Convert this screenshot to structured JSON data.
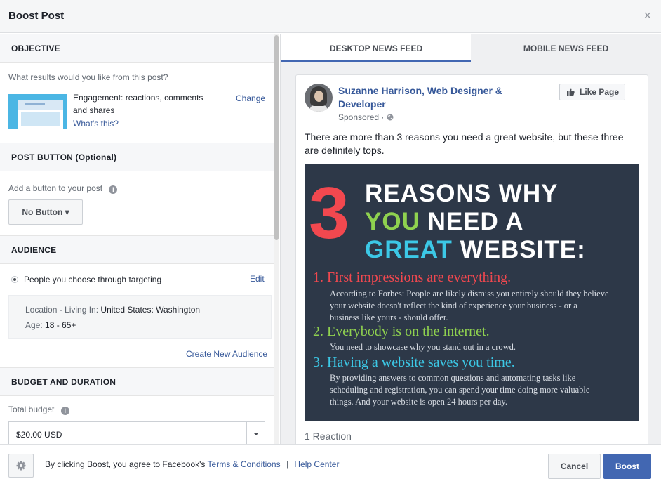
{
  "dialog": {
    "title": "Boost Post",
    "close_glyph": "×"
  },
  "objective": {
    "heading": "OBJECTIVE",
    "question": "What results would you like from this post?",
    "choice_line1": "Engagement: reactions, comments",
    "choice_line2": "and shares",
    "whats_this": "What's this?",
    "change": "Change"
  },
  "post_button": {
    "heading": "POST BUTTON (Optional)",
    "label": "Add a button to your post",
    "info_glyph": "i",
    "selected": "No Button",
    "caret": "▾"
  },
  "audience": {
    "heading": "AUDIENCE",
    "option": "People you choose through targeting",
    "edit": "Edit",
    "location_label": "Location - Living In:",
    "location_value": "United States: Washington",
    "age_label": "Age:",
    "age_value": "18 - 65+",
    "create_new": "Create New Audience"
  },
  "budget": {
    "heading": "BUDGET AND DURATION",
    "total_label": "Total budget",
    "info_glyph": "i",
    "value": "$20.00 USD"
  },
  "preview": {
    "tabs": [
      {
        "label": "DESKTOP NEWS FEED",
        "active": true
      },
      {
        "label": "MOBILE NEWS FEED",
        "active": false
      }
    ],
    "page_name_line1": "Suzanne Harrison, Web Designer &",
    "page_name_line2": "Developer",
    "sponsored": "Sponsored · ",
    "globe_glyph": "🌐",
    "like_page": "Like Page",
    "text_line1": "There are more than 3 reasons you need a great website, but these three",
    "text_line2": "are definitely tops.",
    "image": {
      "number": "3",
      "line1": "REASONS WHY",
      "line2a": "YOU",
      "line2b": "NEED A",
      "line3a": "GREAT",
      "line3b": "WEBSITE:",
      "p1_title": "1.  First impressions are everything.",
      "p1_body1": "According to Forbes: People are likely dismiss you entirely should they believe",
      "p1_body2": "your website doesn't reflect the kind of experience your business - or a",
      "p1_body3": "business like yours - should offer.",
      "p2_title": "2.  Everybody is on the internet.",
      "p2_body1": "You need to showcase why you stand out in a crowd.",
      "p3_title": "3.  Having a website saves you time.",
      "p3_body1": "By providing answers to common questions and automating tasks like",
      "p3_body2": "scheduling and registration, you can spend your time doing more valuable",
      "p3_body3": "things. And your website is open 24 hours per day."
    },
    "reactions": "1 Reaction"
  },
  "footer": {
    "agree_text": "By clicking Boost, you agree to Facebook's",
    "terms": "Terms & Conditions",
    "separator": "|",
    "help_center": "Help Center",
    "cancel": "Cancel",
    "boost": "Boost"
  },
  "colors": {
    "accent": "#4267b2",
    "link": "#365899",
    "hero_bg": "#2d3848",
    "red": "#f2484f",
    "green": "#8fd14f",
    "cyan": "#3cc8e6"
  },
  "icons": [
    "close-icon",
    "info-icon",
    "caret-down-icon",
    "radio-icon",
    "gear-icon",
    "globe-icon",
    "like-thumb-icon",
    "scrollbar"
  ]
}
